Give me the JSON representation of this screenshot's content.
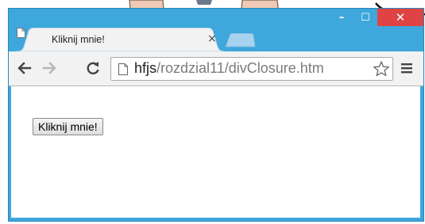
{
  "window": {
    "minimize_glyph": "–",
    "maximize_glyph": "☐",
    "close_glyph": "✕"
  },
  "tab": {
    "title": "Kliknij mnie!",
    "close_glyph": "×"
  },
  "toolbar": {
    "url_host": "hfjs",
    "url_path": "/rozdzial11/divClosure.htm",
    "icons": [
      "back-arrow-icon",
      "forward-arrow-icon",
      "reload-icon",
      "page-icon",
      "bookmark-star-icon",
      "menu-icon"
    ]
  },
  "page": {
    "button_label": "Kliknij mnie!"
  },
  "colors": {
    "frame": "#3ea7dc",
    "close": "#e04343",
    "toolbar": "#f2f2f2",
    "new_tab": "#a7d3ee"
  }
}
